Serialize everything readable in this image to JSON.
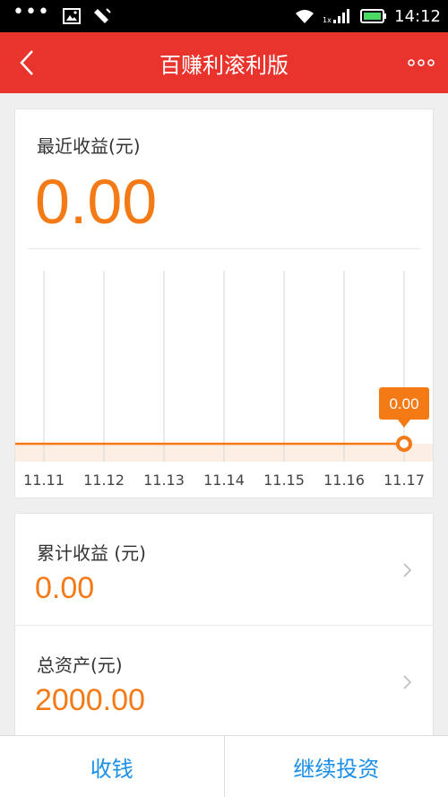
{
  "status_bar": {
    "time": "14:12"
  },
  "header": {
    "title": "百赚利滚利版"
  },
  "earnings": {
    "label": "最近收益(元)",
    "value": "0.00"
  },
  "chart_data": {
    "type": "line",
    "x": [
      "11.11",
      "11.12",
      "11.13",
      "11.14",
      "11.15",
      "11.16",
      "11.17"
    ],
    "values": [
      0,
      0,
      0,
      0,
      0,
      0,
      0
    ],
    "highlight_label": "0.00",
    "colors": {
      "line": "#f47a16",
      "fill": "#fdeee4",
      "grid": "#dcdcdc"
    }
  },
  "summary": {
    "cumulative": {
      "label": "累计收益 (元)",
      "value": "0.00"
    },
    "total_assets": {
      "label": "总资产(元)",
      "value": "2000.00"
    }
  },
  "bottom_bar": {
    "collect_label": "收钱",
    "invest_label": "继续投资"
  },
  "colors": {
    "brand": "#e8342c",
    "accent": "#f47a16",
    "link": "#1b8ee8"
  }
}
